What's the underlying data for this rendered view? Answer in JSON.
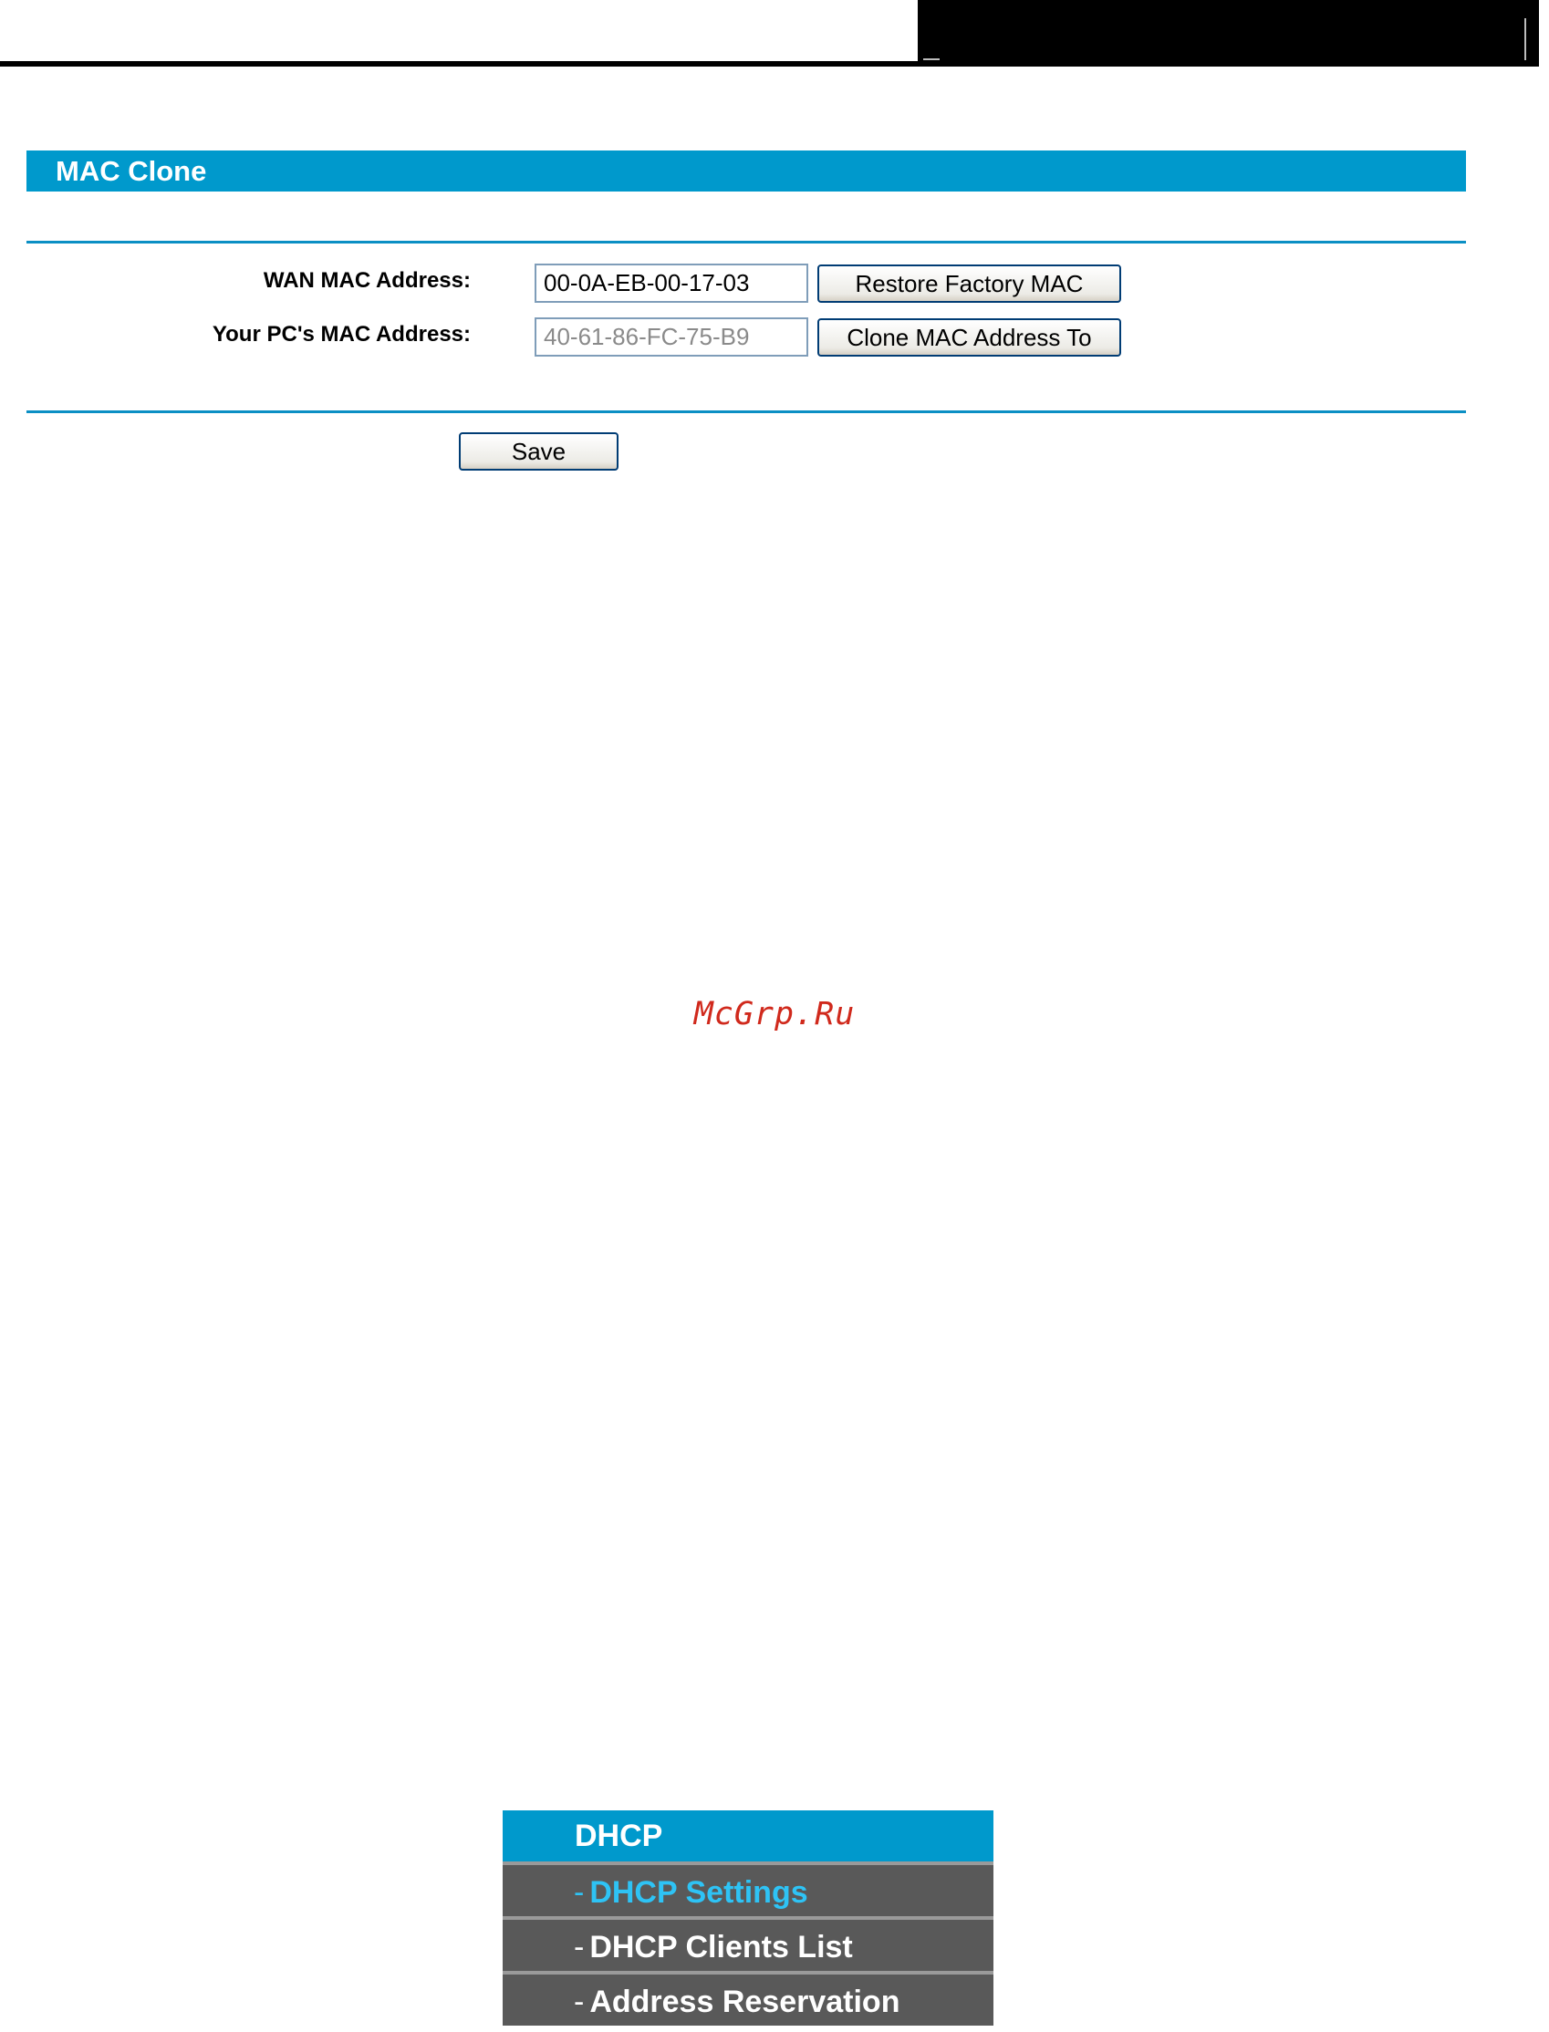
{
  "title": "MAC Clone",
  "fields": {
    "wan_label": "WAN MAC Address:",
    "wan_value": "00-0A-EB-00-17-03",
    "pc_label": "Your PC's MAC Address:",
    "pc_value": "40-61-86-FC-75-B9"
  },
  "buttons": {
    "restore": "Restore Factory MAC",
    "clone": "Clone MAC Address To",
    "save": "Save"
  },
  "watermark": "McGrp.Ru",
  "menu": {
    "header": "DHCP",
    "dash": "-",
    "items": [
      {
        "label": "DHCP Settings",
        "active": true
      },
      {
        "label": "DHCP Clients List",
        "active": false
      },
      {
        "label": "Address Reservation",
        "active": false
      }
    ]
  },
  "colors": {
    "title_bar": "#0099cc",
    "menu_item_bg": "#595959",
    "menu_active_text": "#2ec3f5",
    "watermark": "#d0291c"
  }
}
